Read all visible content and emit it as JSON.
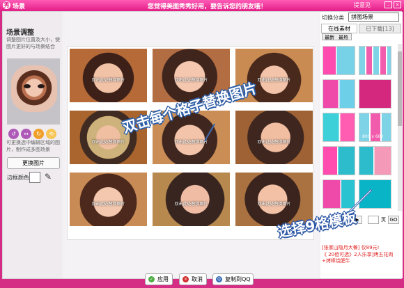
{
  "window": {
    "app_title": "场景",
    "center_title": "您觉得美图秀秀好用，要告诉您的朋友哦！",
    "feedback": "提意见",
    "icon": "app-logo-icon"
  },
  "left": {
    "section_title": "场景调整",
    "description": "调整图片位置及大小，使图片更好的与场景结合",
    "note": "可更换选中编辑区域的图片，制作成多图场景",
    "replace_button": "更换图片",
    "border_color_label": "边框颜色"
  },
  "canvas": {
    "cell_label": "双击此处替换图片",
    "hint_text": "双击每个格子替换图片"
  },
  "buttons": {
    "apply": "应用",
    "cancel": "取消",
    "copy": "复制到QQ"
  },
  "right": {
    "switch_label": "切换分类",
    "category": "拼图场景",
    "tab_online": "在线素材",
    "tab_downloaded": "已下载[13]",
    "filter_latest": "最新",
    "filter_hot": "最热",
    "thumb_size": "800 x 600",
    "page_go": "GO",
    "page_word": "页",
    "ad_1": "[张家山隐月大餐] 仅89元!",
    "ad_2": "《 20佰可选》2人乐享]烤五花肉+烤棒烧肥牛",
    "hint_text": "选择9格模板"
  }
}
